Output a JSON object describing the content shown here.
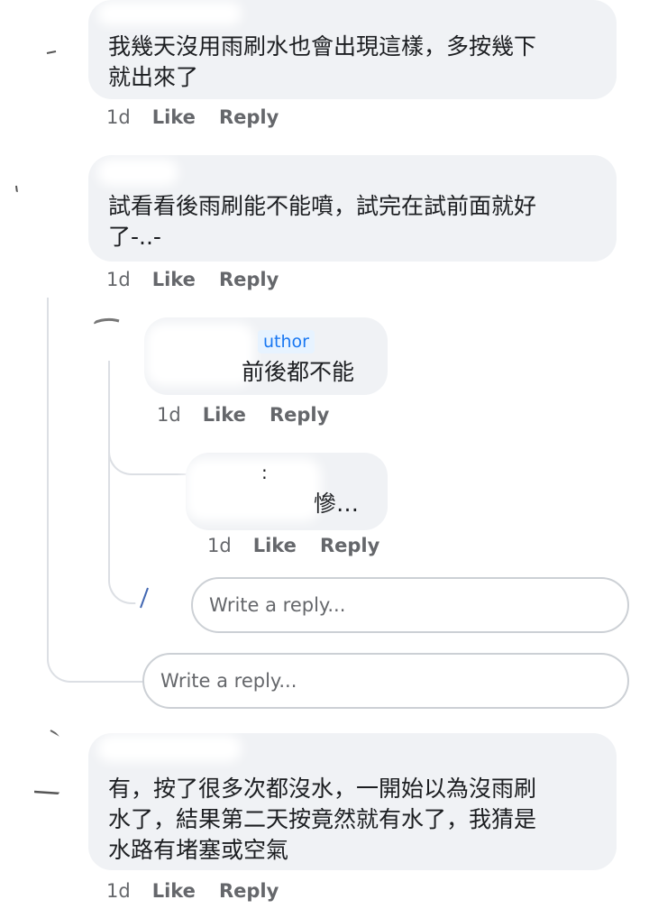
{
  "comments": [
    {
      "text_line1": "我幾天沒用雨刷水也會出現這樣，多按幾下",
      "text_line2": "就出來了",
      "time": "1d",
      "like": "Like",
      "reply": "Reply"
    },
    {
      "text_line1": "試看看後雨刷能不能噴，試完在試前面就好",
      "text_line2": "了-..-",
      "time": "1d",
      "like": "Like",
      "reply": "Reply",
      "replies": [
        {
          "badge": "uthor",
          "text": "前後都不能",
          "time": "1d",
          "like": "Like",
          "reply": "Reply"
        },
        {
          "name_fragment": ":",
          "text": "慘…",
          "time": "1d",
          "like": "Like",
          "reply": "Reply"
        }
      ],
      "nested_reply_placeholder": "Write a reply..."
    },
    {
      "text_line1": "有，按了很多次都沒水，一開始以為沒雨刷",
      "text_line2": "水了，結果第二天按竟然就有水了，我猜是",
      "text_line3": "水路有堵塞或空氣",
      "time": "1d",
      "like": "Like",
      "reply": "Reply"
    }
  ],
  "thread_reply_placeholder": "Write a reply...",
  "colors": {
    "bubble": "#f0f2f5",
    "meta": "#65676b",
    "badge_bg": "#e7f3ff",
    "badge_text": "#1877f2",
    "thread_line": "#dcdfe4"
  }
}
